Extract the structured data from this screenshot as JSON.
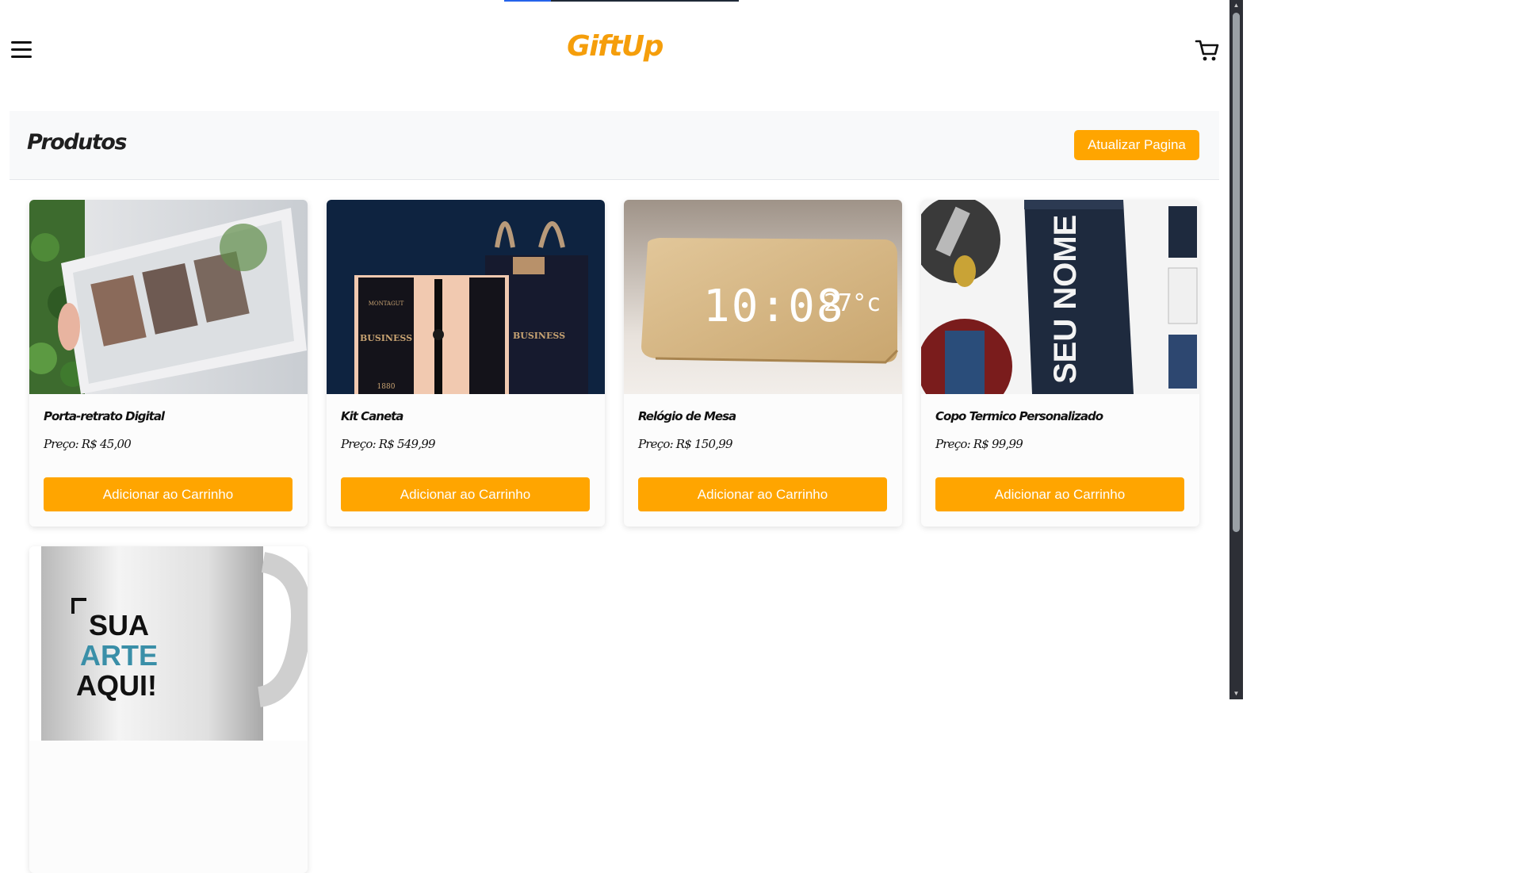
{
  "brand": {
    "logo_text": "GiftUp",
    "accent_color": "#ffa500",
    "logo_color": "#f59e0b"
  },
  "header": {
    "menu_icon": "hamburger-menu-icon",
    "cart_icon": "shopping-cart-icon"
  },
  "loading_bar": {
    "progress": 0.2
  },
  "section": {
    "title": "Produtos",
    "refresh_label": "Atualizar Pagina"
  },
  "products": [
    {
      "name": "Porta-retrato Digital",
      "price": "Preço: R$ 45,00",
      "button": "Adicionar ao Carrinho",
      "image": "photo-frame-with-family-pictures"
    },
    {
      "name": "Kit Caneta",
      "price": "Preço: R$ 549,99",
      "button": "Adicionar ao Carrinho",
      "image": "montagut-pen-gift-set",
      "image_text": {
        "brand": "MONTAGUT",
        "label": "BUSINESS",
        "year": "1880"
      }
    },
    {
      "name": "Relógio de Mesa",
      "price": "Preço: R$ 150,99",
      "button": "Adicionar ao Carrinho",
      "image": "wooden-led-desk-clock",
      "image_text": {
        "time": "10:08",
        "temp": "27°c"
      }
    },
    {
      "name": "Copo Termico Personalizado",
      "price": "Preço: R$ 99,99",
      "button": "Adicionar ao Carrinho",
      "image": "personalized-thermal-tumbler",
      "image_text": {
        "engraving": "SEU NOME"
      }
    },
    {
      "image": "custom-mug",
      "image_text": {
        "line1": "SUA",
        "line2": "ARTE",
        "line3": "AQUI!"
      }
    }
  ]
}
